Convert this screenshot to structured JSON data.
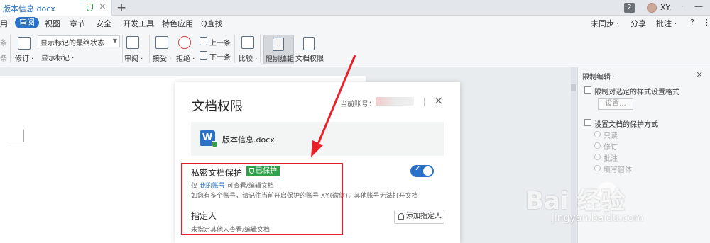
{
  "tabbar": {
    "doc_tab": "版本信息.docx",
    "close": "×",
    "add": "+",
    "count": "2",
    "user": "XY.",
    "user_menu": "·",
    "minimize": "—"
  },
  "menu": {
    "items": [
      {
        "label": "用"
      },
      {
        "label": "审阅",
        "active": true
      },
      {
        "label": "视图"
      },
      {
        "label": "章节"
      },
      {
        "label": "安全"
      },
      {
        "label": "开发工具"
      },
      {
        "label": "特色应用"
      },
      {
        "label": "Q查找"
      }
    ],
    "right": [
      "未同步 ·",
      "分享",
      "批注 ·",
      "?",
      "⋮"
    ]
  },
  "ribbon": {
    "left_partial": [
      "条",
      "条"
    ],
    "revise": "修订 ·",
    "display_select": "显示标记的最终状态",
    "show_markup": "显示标记 ·",
    "review": "审阅 ·",
    "accept": "接受 ·",
    "reject": "拒绝 ·",
    "prev": "上一条",
    "next": "下一条",
    "compare": "比较 ·",
    "restrict_edit": "限制编辑",
    "doc_permission": "文档权限"
  },
  "sidepanel": {
    "title": "限制编辑 ·",
    "opt1": "限制对选定的样式设置格式",
    "settings": "设置...",
    "opt2": "设置文档的保护方式",
    "radios": [
      "只读",
      "修订",
      "批注",
      "填写窗体"
    ]
  },
  "dialog": {
    "title": "文档权限",
    "account_label": "当前账号：",
    "close": "×",
    "file_name": "版本信息.docx",
    "wps_letter": "W",
    "private_title": "私密文档保护",
    "protected_badge": "已保护",
    "toggle_on": true,
    "only_prefix": "仅",
    "my_account": "我的账号",
    "only_suffix": "可查看/编辑文档",
    "multi_account_note": "如您有多个账号，请记住当前开启保护的账号 XY.(微信)，其他账号无法打开文档",
    "assign_title": "指定人",
    "assign_desc": "未指定其他人查看/编辑文档",
    "add_button": "添加指定人"
  },
  "watermark": {
    "brand": "Bai 经验",
    "url": "jingyan.baidu.com"
  },
  "colors": {
    "accent": "#2a72c8",
    "protected": "#2fa14a",
    "highlight_red": "#e8202a"
  }
}
